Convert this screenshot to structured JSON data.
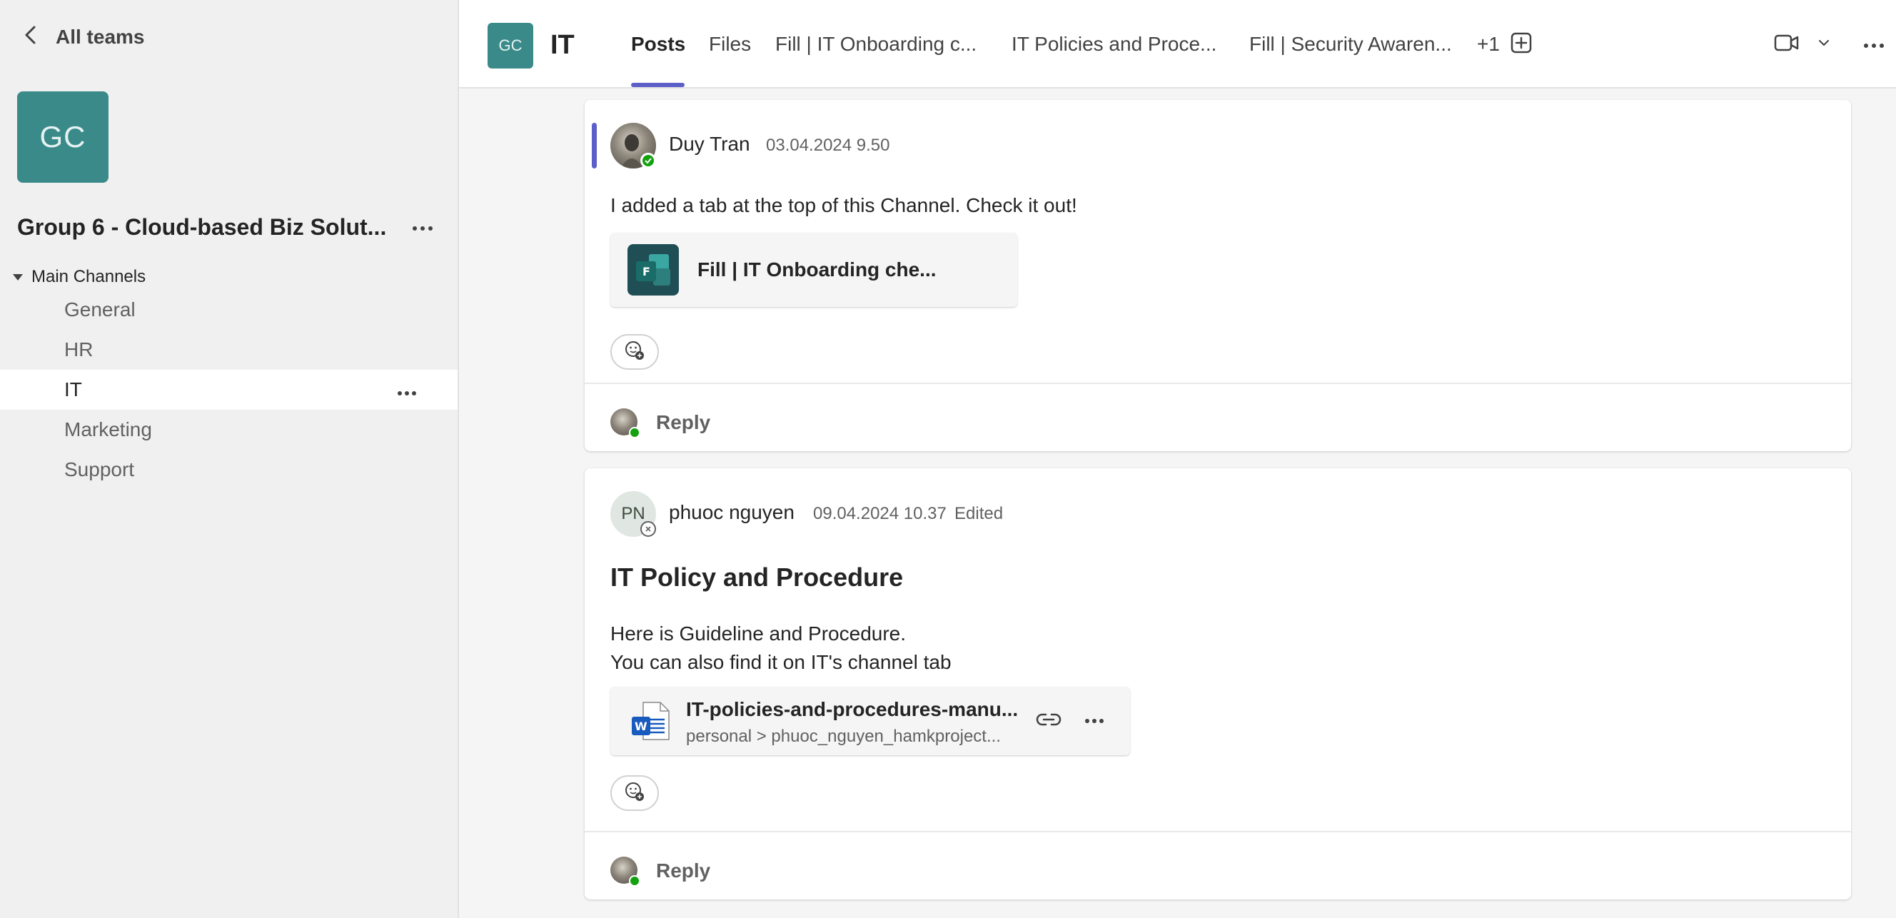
{
  "sidebar": {
    "back_label": "All teams",
    "team_initials": "GC",
    "team_name": "Group 6 - Cloud-based Biz Solut...",
    "section_label": "Main Channels",
    "channels": [
      {
        "label": "General"
      },
      {
        "label": "HR"
      },
      {
        "label": "IT"
      },
      {
        "label": "Marketing"
      },
      {
        "label": "Support"
      }
    ]
  },
  "header": {
    "avatar_initials": "GC",
    "channel_title": "IT",
    "tabs": [
      {
        "label": "Posts"
      },
      {
        "label": "Files"
      },
      {
        "label": "Fill | IT Onboarding c..."
      },
      {
        "label": "IT Policies and Proce..."
      },
      {
        "label": "Fill | Security Awaren..."
      }
    ],
    "more_tabs": "+1",
    "icons": [
      "add-tab-icon",
      "video-call-icon",
      "chevron-down-icon",
      "more-icon"
    ]
  },
  "posts": [
    {
      "author": "Duy Tran",
      "timestamp": "03.04.2024 9.50",
      "text": "I added a tab at the top of this Channel. Check it out!",
      "attachment": {
        "title": "Fill | IT Onboarding che...",
        "icon": "forms-icon"
      },
      "reply_label": "Reply"
    },
    {
      "author": "phuoc nguyen",
      "avatar_initials": "PN",
      "timestamp": "09.04.2024 10.37",
      "edited": "Edited",
      "heading": "IT Policy and Procedure",
      "text_line1": "Here is Guideline and Procedure.",
      "text_line2": "You can also find it on IT's channel tab",
      "attachment": {
        "title": "IT-policies-and-procedures-manu...",
        "path": "personal > phuoc_nguyen_hamkproject...",
        "icon": "word-icon"
      },
      "reply_label": "Reply"
    }
  ],
  "colors": {
    "accent": "#5b5fc7",
    "team_avatar": "#3b8a8a",
    "presence_available": "#13a10e"
  }
}
